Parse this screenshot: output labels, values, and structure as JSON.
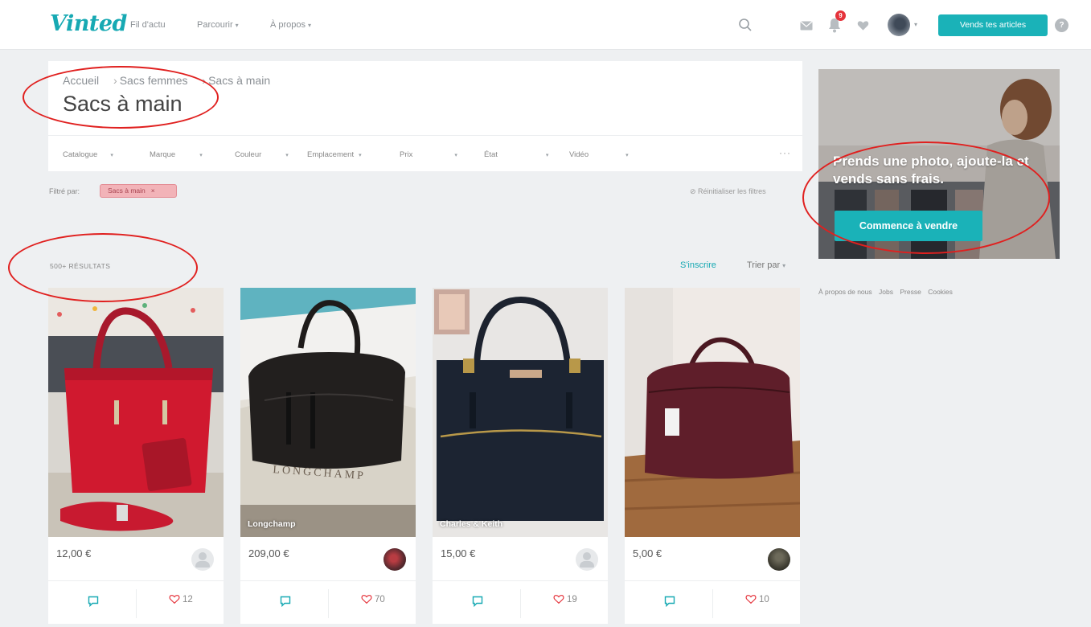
{
  "header": {
    "logo": "Vinted",
    "nav_feed": "Fil d'actu",
    "nav_browse": "Parcourir",
    "nav_about": "À propos",
    "notifications_count": "9",
    "sell_button": "Vends tes articles",
    "help": "?"
  },
  "catalog": {
    "breadcrumb": [
      "Accueil",
      "Sacs femmes",
      "Sacs à main"
    ],
    "title": "Sacs à main",
    "filters": [
      "Catalogue",
      "Marque",
      "Couleur",
      "Emplacement",
      "Prix",
      "État",
      "Vidéo"
    ],
    "more_filters": "···",
    "filtered_by_label": "Filtré par:",
    "active_filter": "Sacs à main",
    "reset_filters": "Réinitialiser les filtres",
    "results_count": "500+ RÉSULTATS",
    "save_search": "S'inscrire",
    "sort_by": "Trier par"
  },
  "products": [
    {
      "brand": "",
      "price": "12,00 €",
      "likes": "12"
    },
    {
      "brand": "Longchamp",
      "price": "209,00 €",
      "likes": "70"
    },
    {
      "brand": "Charles & Keith",
      "price": "15,00 €",
      "likes": "19"
    },
    {
      "brand": "",
      "price": "5,00 €",
      "likes": "10"
    }
  ],
  "promo": {
    "text": "Prends une photo, ajoute-la et vends sans frais.",
    "button": "Commence à vendre"
  },
  "footer": [
    "À propos de nous",
    "Jobs",
    "Presse",
    "Cookies"
  ],
  "colors": {
    "accent": "#1ab2b8",
    "badge": "#e5333b",
    "chip": "#f2b3b8",
    "annotation": "#e0201f"
  }
}
